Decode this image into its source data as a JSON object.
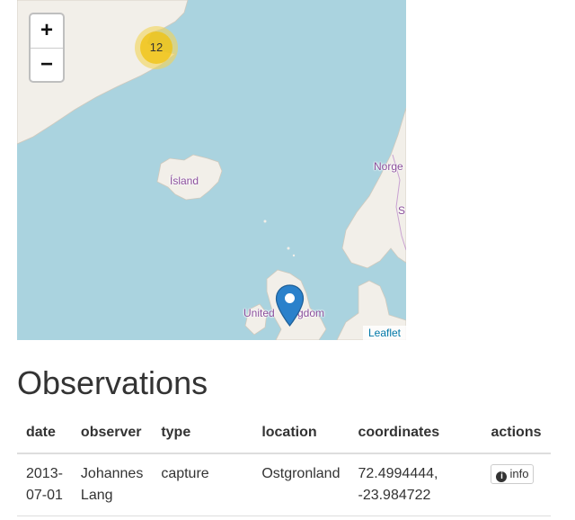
{
  "map": {
    "zoom_in_label": "+",
    "zoom_out_label": "−",
    "cluster_count": "12",
    "labels": {
      "iceland": "Ísland",
      "norway": "Norge",
      "sweden": "S",
      "uk_left": "United",
      "uk_right": "gdom"
    },
    "attribution": "Leaflet",
    "colors": {
      "water": "#aad3df",
      "land": "#f2efe9",
      "cluster_outer": "#f1d357",
      "cluster_inner": "#f0c20c",
      "marker": "#2a81cb"
    },
    "icons": [
      "map-marker-icon"
    ]
  },
  "heading": "Observations",
  "table": {
    "columns": [
      "date",
      "observer",
      "type",
      "location",
      "coordinates",
      "actions"
    ],
    "rows": [
      {
        "date": "2013-\n07-01",
        "observer": "Johannes\nLang",
        "type": "capture",
        "location": "Ostgronland",
        "coordinates": "72.4994444,\n-23.984722",
        "action_label": "info"
      }
    ]
  }
}
